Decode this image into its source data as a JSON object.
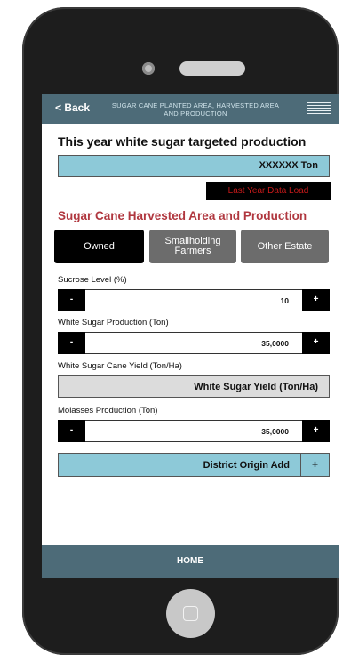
{
  "topbar": {
    "back_label": "< Back",
    "title": "SUGAR CANE PLANTED AREA, HARVESTED AREA AND PRODUCTION"
  },
  "target": {
    "title": "This year white sugar targeted production",
    "value": "XXXXXX Ton"
  },
  "last_year_button": "Last Year Data Load",
  "section_title": "Sugar Cane Harvested Area and Production",
  "tabs": [
    {
      "label": "Owned",
      "active": true
    },
    {
      "label": "Smallholding Farmers",
      "active": false
    },
    {
      "label": "Other Estate",
      "active": false
    }
  ],
  "fields": {
    "sucrose": {
      "label": "Sucrose Level (%)",
      "value": "10",
      "minus": "-",
      "plus": "+"
    },
    "white_sugar_production": {
      "label": "White Sugar Production (Ton)",
      "value": "35,0000",
      "minus": "-",
      "plus": "+"
    },
    "white_sugar_yield": {
      "label": "White Sugar Cane Yield (Ton/Ha)",
      "value": "White Sugar Yield (Ton/Ha)"
    },
    "molasses": {
      "label": "Molasses Production (Ton)",
      "value": "35,0000",
      "minus": "-",
      "plus": "+"
    }
  },
  "district": {
    "label": "District Origin Add",
    "add": "+"
  },
  "footer": {
    "home_label": "HOME"
  },
  "colors": {
    "header": "#4d6b78",
    "highlight_box": "#8dc9d8",
    "section_title": "#b0373f",
    "load_text": "#c81a1a"
  }
}
